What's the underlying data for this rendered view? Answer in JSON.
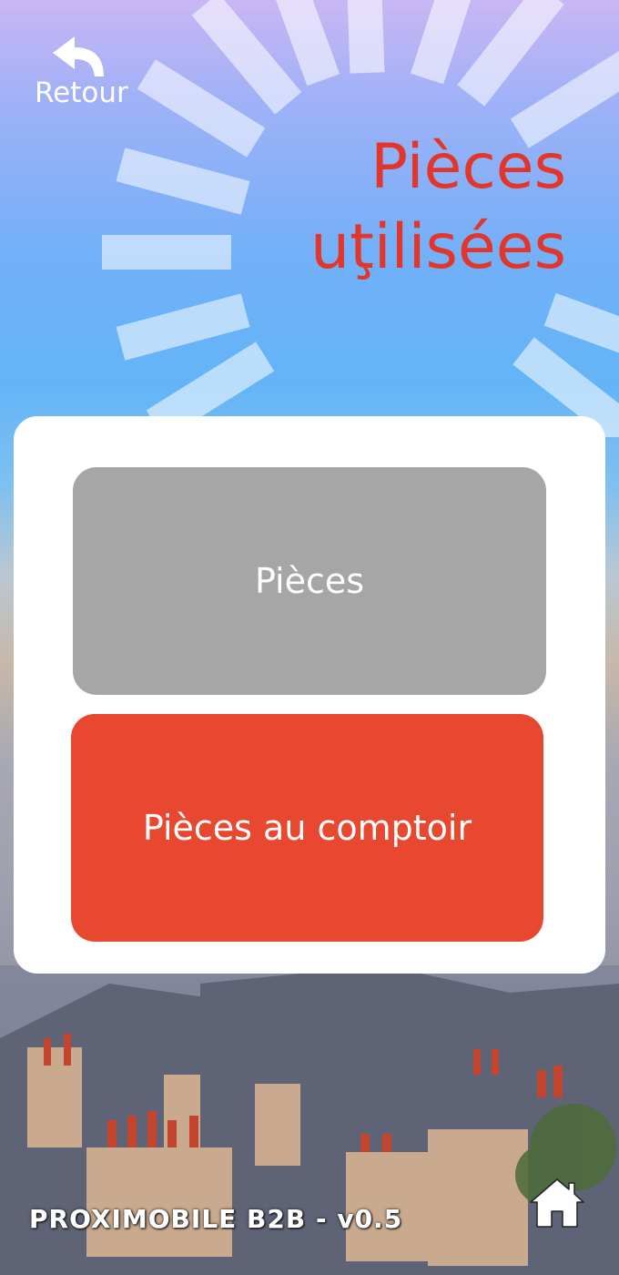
{
  "header": {
    "back_label": "Retour",
    "title_line1": "Pièces",
    "title_line2": "uţilisées"
  },
  "menu": {
    "parts_label": "Pièces",
    "counter_parts_label": "Pièces au comptoir"
  },
  "footer": {
    "app_version_label": "PROXIMOBILE B2B - v0.5"
  },
  "icons": {
    "back": "back-arrow-icon",
    "home": "home-icon"
  },
  "colors": {
    "title": "#e2362a",
    "parts_button": "#a6a6a6",
    "counter_button": "#e84830",
    "panel": "#ffffff"
  }
}
